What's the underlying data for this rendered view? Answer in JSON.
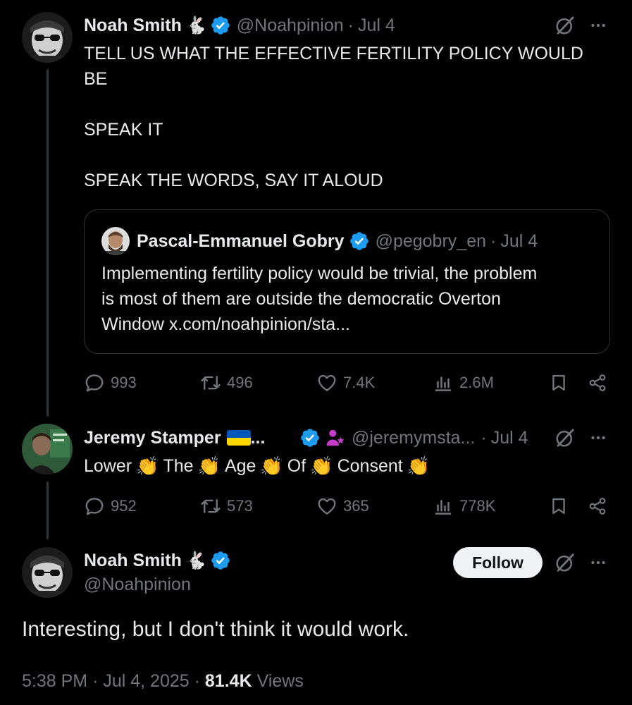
{
  "tweet1": {
    "name": "Noah Smith",
    "name_emoji": "🐇",
    "handle": "@Noahpinion",
    "sep": "·",
    "date": "Jul 4",
    "text": "TELL US WHAT THE EFFECTIVE FERTILITY POLICY WOULD\nBE\n\nSPEAK IT\n\nSPEAK THE WORDS, SAY IT ALOUD",
    "quote": {
      "name": "Pascal-Emmanuel Gobry",
      "handle": "@pegobry_en",
      "sep": "·",
      "date": "Jul 4",
      "text": "Implementing fertility policy would be trivial, the problem\nis most of them are outside the democratic Overton\nWindow x.com/noahpinion/sta..."
    },
    "stats": {
      "replies": "993",
      "reposts": "496",
      "likes": "7.4K",
      "views": "2.6M"
    }
  },
  "tweet2": {
    "name": "Jeremy Stamper",
    "flag_emoji": "🇺🇦",
    "ellipsis": "...",
    "handle": "@jeremymsta...",
    "sep": "·",
    "date": "Jul 4",
    "words": [
      "Lower",
      "The",
      "Age",
      "Of",
      "Consent"
    ],
    "clap_emoji": "👏",
    "stats": {
      "replies": "952",
      "reposts": "573",
      "likes": "365",
      "views": "778K"
    }
  },
  "main": {
    "name": "Noah Smith",
    "name_emoji": "🐇",
    "handle": "@Noahpinion",
    "follow_label": "Follow",
    "text": "Interesting, but I don't think it would work.",
    "time": "5:38 PM",
    "sep1": "·",
    "date": "Jul 4, 2025",
    "sep2": "·",
    "views_count": "81.4K",
    "views_label": "Views"
  },
  "colors": {
    "verified": "#1d9bf0",
    "muted": "#71767b",
    "text": "#e7e9ea",
    "border": "#2f3336"
  },
  "icons": [
    "verified-badge-icon",
    "grok-icon",
    "more-icon",
    "reply-icon",
    "repost-icon",
    "like-icon",
    "views-icon",
    "bookmark-icon",
    "share-icon"
  ]
}
